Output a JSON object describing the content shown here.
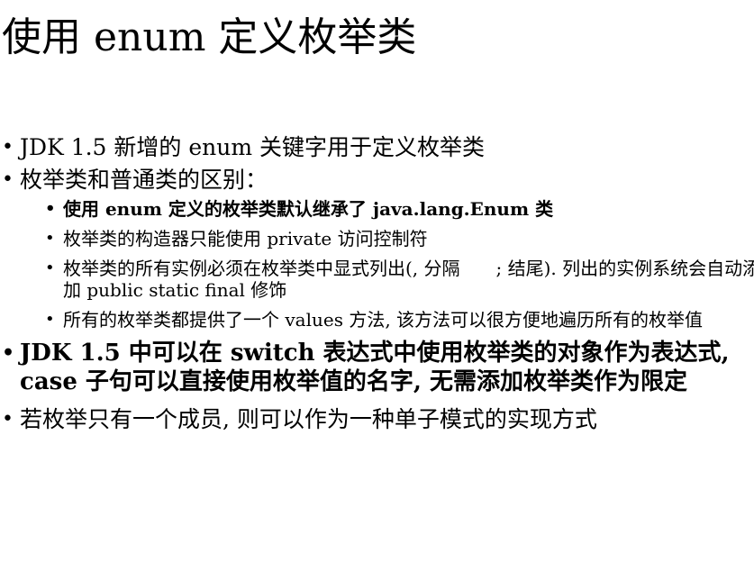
{
  "slide": {
    "title": "使用 enum 定义枚举类",
    "bullets": [
      {
        "text": "JDK 1.5 新增的 enum 关键字用于定义枚举类"
      },
      {
        "text": "枚举类和普通类的区别：",
        "sub": [
          "使用 enum 定义的枚举类默认继承了 java.lang.Enum 类",
          "枚举类的构造器只能使用 private 访问控制符",
          "枚举类的所有实例必须在枚举类中显式列出(, 分隔　　; 结尾). 列出的实例系统会自动添加 public static final 修饰",
          "所有的枚举类都提供了一个 values 方法, 该方法可以很方便地遍历所有的枚举值"
        ]
      },
      {
        "text": "JDK 1.5 中可以在 switch 表达式中使用枚举类的对象作为表达式, case 子句可以直接使用枚举值的名字, 无需添加枚举类作为限定"
      },
      {
        "text": "若枚举只有一个成员, 则可以作为一种单子模式的实现方式"
      }
    ]
  },
  "icons": {
    "bullet": "bullet-dot"
  }
}
